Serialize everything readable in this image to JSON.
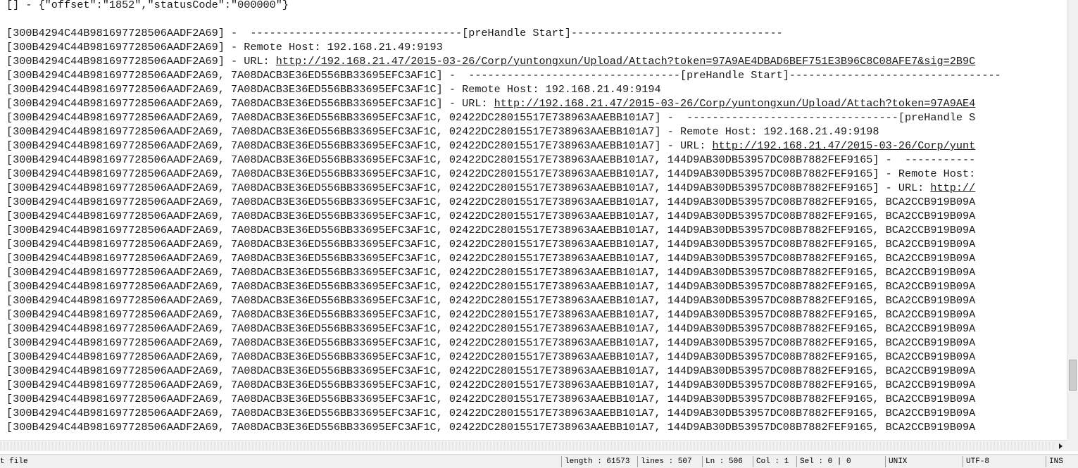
{
  "log_lines": [
    "[] - {\"offset\":\"1852\",\"statusCode\":\"000000\"}",
    "",
    "[300B4294C44B981697728506AADF2A69] -  ---------------------------------[preHandle Start]---------------------------------",
    "[300B4294C44B981697728506AADF2A69] - Remote Host: 192.168.21.49:9193",
    [
      "[300B4294C44B981697728506AADF2A69] - URL: ",
      "http://192.168.21.47/2015-03-26/Corp/yuntongxun/Upload/Attach?token=97A9AE4DBAD6BEF751E3B96C8C08AFE7&sig=2B9C"
    ],
    "[300B4294C44B981697728506AADF2A69, 7A08DACB3E36ED556BB33695EFC3AF1C] -  ---------------------------------[preHandle Start]---------------------------------",
    "[300B4294C44B981697728506AADF2A69, 7A08DACB3E36ED556BB33695EFC3AF1C] - Remote Host: 192.168.21.49:9194",
    [
      "[300B4294C44B981697728506AADF2A69, 7A08DACB3E36ED556BB33695EFC3AF1C] - URL: ",
      "http://192.168.21.47/2015-03-26/Corp/yuntongxun/Upload/Attach?token=97A9AE4"
    ],
    "[300B4294C44B981697728506AADF2A69, 7A08DACB3E36ED556BB33695EFC3AF1C, 02422DC28015517E738963AAEBB101A7] -  ---------------------------------[preHandle S",
    "[300B4294C44B981697728506AADF2A69, 7A08DACB3E36ED556BB33695EFC3AF1C, 02422DC28015517E738963AAEBB101A7] - Remote Host: 192.168.21.49:9198",
    [
      "[300B4294C44B981697728506AADF2A69, 7A08DACB3E36ED556BB33695EFC3AF1C, 02422DC28015517E738963AAEBB101A7] - URL: ",
      "http://192.168.21.47/2015-03-26/Corp/yunt"
    ],
    "[300B4294C44B981697728506AADF2A69, 7A08DACB3E36ED556BB33695EFC3AF1C, 02422DC28015517E738963AAEBB101A7, 144D9AB30DB53957DC08B7882FEF9165] -  -----------",
    "[300B4294C44B981697728506AADF2A69, 7A08DACB3E36ED556BB33695EFC3AF1C, 02422DC28015517E738963AAEBB101A7, 144D9AB30DB53957DC08B7882FEF9165] - Remote Host:",
    [
      "[300B4294C44B981697728506AADF2A69, 7A08DACB3E36ED556BB33695EFC3AF1C, 02422DC28015517E738963AAEBB101A7, 144D9AB30DB53957DC08B7882FEF9165] - URL: ",
      "http://"
    ],
    "[300B4294C44B981697728506AADF2A69, 7A08DACB3E36ED556BB33695EFC3AF1C, 02422DC28015517E738963AAEBB101A7, 144D9AB30DB53957DC08B7882FEF9165, BCA2CCB919B09A",
    "[300B4294C44B981697728506AADF2A69, 7A08DACB3E36ED556BB33695EFC3AF1C, 02422DC28015517E738963AAEBB101A7, 144D9AB30DB53957DC08B7882FEF9165, BCA2CCB919B09A",
    "[300B4294C44B981697728506AADF2A69, 7A08DACB3E36ED556BB33695EFC3AF1C, 02422DC28015517E738963AAEBB101A7, 144D9AB30DB53957DC08B7882FEF9165, BCA2CCB919B09A",
    "[300B4294C44B981697728506AADF2A69, 7A08DACB3E36ED556BB33695EFC3AF1C, 02422DC28015517E738963AAEBB101A7, 144D9AB30DB53957DC08B7882FEF9165, BCA2CCB919B09A",
    "[300B4294C44B981697728506AADF2A69, 7A08DACB3E36ED556BB33695EFC3AF1C, 02422DC28015517E738963AAEBB101A7, 144D9AB30DB53957DC08B7882FEF9165, BCA2CCB919B09A",
    "[300B4294C44B981697728506AADF2A69, 7A08DACB3E36ED556BB33695EFC3AF1C, 02422DC28015517E738963AAEBB101A7, 144D9AB30DB53957DC08B7882FEF9165, BCA2CCB919B09A",
    "[300B4294C44B981697728506AADF2A69, 7A08DACB3E36ED556BB33695EFC3AF1C, 02422DC28015517E738963AAEBB101A7, 144D9AB30DB53957DC08B7882FEF9165, BCA2CCB919B09A",
    "[300B4294C44B981697728506AADF2A69, 7A08DACB3E36ED556BB33695EFC3AF1C, 02422DC28015517E738963AAEBB101A7, 144D9AB30DB53957DC08B7882FEF9165, BCA2CCB919B09A",
    "[300B4294C44B981697728506AADF2A69, 7A08DACB3E36ED556BB33695EFC3AF1C, 02422DC28015517E738963AAEBB101A7, 144D9AB30DB53957DC08B7882FEF9165, BCA2CCB919B09A",
    "[300B4294C44B981697728506AADF2A69, 7A08DACB3E36ED556BB33695EFC3AF1C, 02422DC28015517E738963AAEBB101A7, 144D9AB30DB53957DC08B7882FEF9165, BCA2CCB919B09A",
    "[300B4294C44B981697728506AADF2A69, 7A08DACB3E36ED556BB33695EFC3AF1C, 02422DC28015517E738963AAEBB101A7, 144D9AB30DB53957DC08B7882FEF9165, BCA2CCB919B09A",
    "[300B4294C44B981697728506AADF2A69, 7A08DACB3E36ED556BB33695EFC3AF1C, 02422DC28015517E738963AAEBB101A7, 144D9AB30DB53957DC08B7882FEF9165, BCA2CCB919B09A",
    "[300B4294C44B981697728506AADF2A69, 7A08DACB3E36ED556BB33695EFC3AF1C, 02422DC28015517E738963AAEBB101A7, 144D9AB30DB53957DC08B7882FEF9165, BCA2CCB919B09A",
    "[300B4294C44B981697728506AADF2A69, 7A08DACB3E36ED556BB33695EFC3AF1C, 02422DC28015517E738963AAEBB101A7, 144D9AB30DB53957DC08B7882FEF9165, BCA2CCB919B09A",
    "[300B4294C44B981697728506AADF2A69, 7A08DACB3E36ED556BB33695EFC3AF1C, 02422DC28015517E738963AAEBB101A7, 144D9AB30DB53957DC08B7882FEF9165, BCA2CCB919B09A",
    "[300B4294C44B981697728506AADF2A69, 7A08DACB3E36ED556BB33695EFC3AF1C, 02422DC28015517E738963AAEBB101A7, 144D9AB30DB53957DC08B7882FEF9165, BCA2CCB919B09A",
    "[300B4294C44B981697728506AADF2A69, 7A08DACB3E36ED556BB33695EFC3AF1C, 02422DC28015517E738963AAEBB101A7, 144D9AB30DB53957DC08B7882FEF9165, BCA2CCB919B09A"
  ],
  "scrollbars": {
    "vertical_position": 0.88
  },
  "status_bar": {
    "file_type": "t file",
    "length": "length : 61573",
    "lines": "lines : 507",
    "ln": "Ln : 506",
    "col": "Col : 1",
    "sel": "Sel : 0 | 0",
    "eol": "UNIX",
    "encoding": "UTF-8",
    "mode": "INS"
  }
}
